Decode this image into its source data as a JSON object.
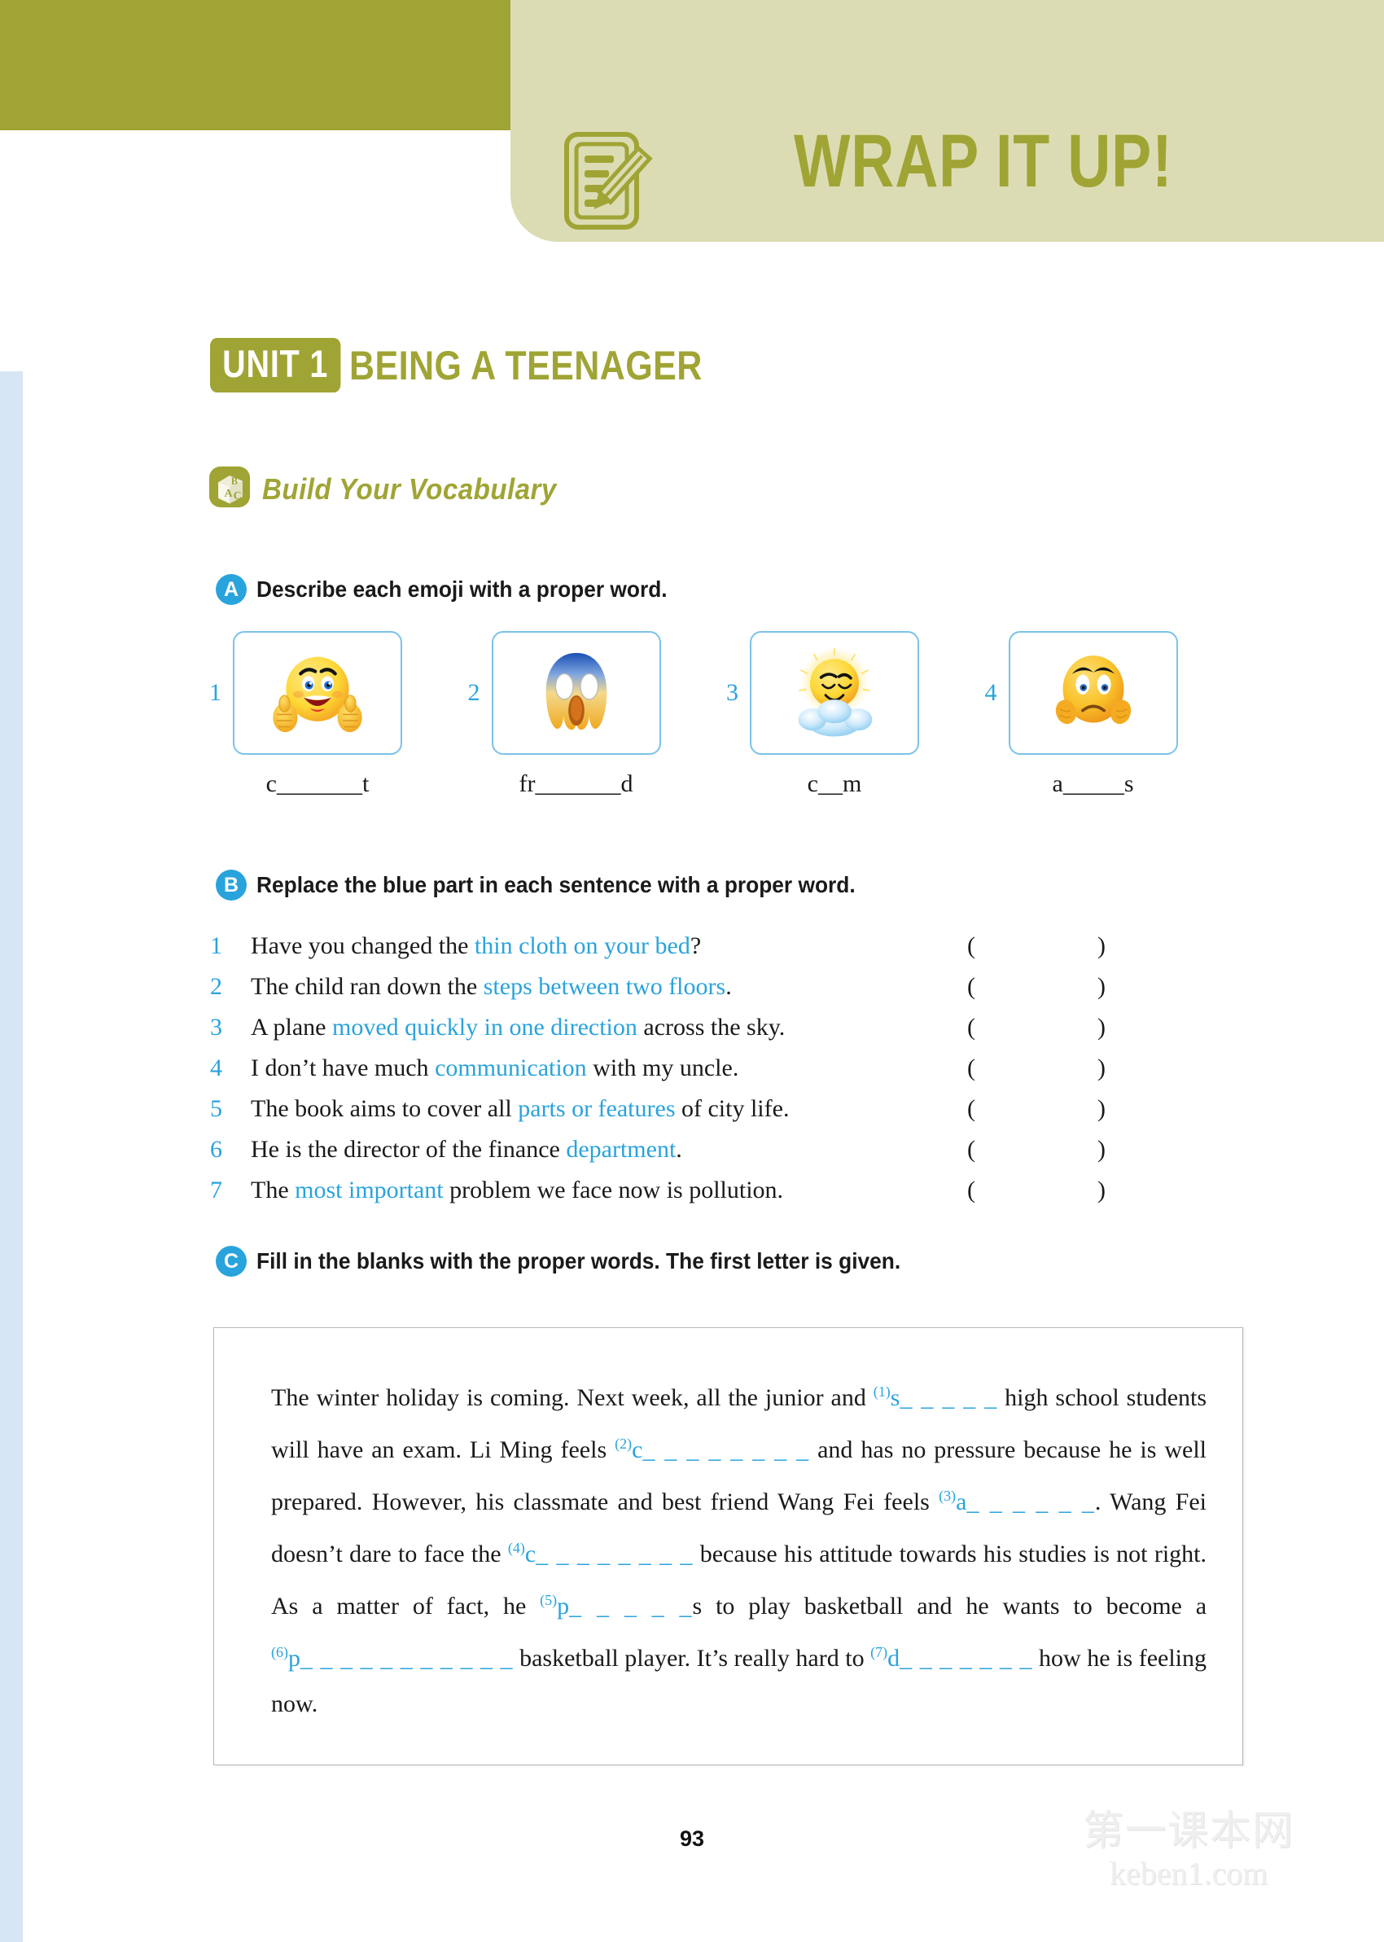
{
  "header": {
    "title": "WRAP IT UP!",
    "icon": "notepad-pencil-icon",
    "accent_color": "#a0a434",
    "band_color": "#dcdcb4"
  },
  "unit": {
    "badge": "UNIT 1",
    "name": "BEING A TEENAGER"
  },
  "vocabulary": {
    "icon": "abc-block-icon",
    "label": "Build Your Vocabulary"
  },
  "sections": {
    "a": {
      "badge": "A",
      "instruction": "Describe each emoji with a proper word.",
      "items": [
        {
          "num": "1",
          "emoji": "thumbs-up-smiley-emoji",
          "answer": "c_______t"
        },
        {
          "num": "2",
          "emoji": "screaming-face-emoji",
          "answer": "fr_______d"
        },
        {
          "num": "3",
          "emoji": "sleeping-on-cloud-emoji",
          "answer": "c__m"
        },
        {
          "num": "4",
          "emoji": "worried-face-emoji",
          "answer": "a_____s"
        }
      ]
    },
    "b": {
      "badge": "B",
      "instruction": "Replace the blue part in each sentence with a proper word.",
      "open_paren": "(",
      "close_paren": ")",
      "items": [
        {
          "num": "1",
          "pre": "Have you changed the ",
          "blue": "thin cloth on your bed",
          "post": "?"
        },
        {
          "num": "2",
          "pre": "The child ran down the ",
          "blue": "steps between two floors",
          "post": "."
        },
        {
          "num": "3",
          "pre": "A plane ",
          "blue": "moved quickly in one direction",
          "post": " across the sky."
        },
        {
          "num": "4",
          "pre": "I don’t have much ",
          "blue": "communication",
          "post": " with my uncle."
        },
        {
          "num": "5",
          "pre": "The book aims to cover all ",
          "blue": "parts or features",
          "post": " of city life."
        },
        {
          "num": "6",
          "pre": "He is the director of the finance ",
          "blue": "department",
          "post": "."
        },
        {
          "num": "7",
          "pre": "The ",
          "blue": "most important",
          "post": " problem we face now is pollution."
        }
      ]
    },
    "c": {
      "badge": "C",
      "instruction": "Fill in the blanks with the proper words. The first letter is given.",
      "passage_segments": [
        {
          "type": "text",
          "value": "The winter holiday is coming. Next week, all the junior and "
        },
        {
          "type": "blank",
          "num": "(1)",
          "letter": "s",
          "dashes": "_ _ _ _ _"
        },
        {
          "type": "text",
          "value": " high school students will have an exam. Li Ming feels "
        },
        {
          "type": "blank",
          "num": "(2)",
          "letter": "c",
          "dashes": "_ _ _ _ _ _ _ _"
        },
        {
          "type": "text",
          "value": " and has no pressure because he is well prepared. However, his classmate and best friend Wang Fei feels "
        },
        {
          "type": "blank",
          "num": "(3)",
          "letter": "a",
          "dashes": "_ _ _ _ _ _"
        },
        {
          "type": "text",
          "value": ". Wang Fei doesn’t dare to face the "
        },
        {
          "type": "blank",
          "num": "(4)",
          "letter": "c",
          "dashes": "_ _ _ _ _ _ _ _"
        },
        {
          "type": "text",
          "value": " because his attitude towards his studies is not right. As a matter of fact, he "
        },
        {
          "type": "blank",
          "num": "(5)",
          "letter": "p",
          "dashes": "_ _ _ _ _"
        },
        {
          "type": "text",
          "value": "s to play basketball and he wants to become a "
        },
        {
          "type": "blank",
          "num": "(6)",
          "letter": "p",
          "dashes": "_ _ _ _ _ _ _ _ _ _ _"
        },
        {
          "type": "text",
          "value": " basketball player. It’s really hard to "
        },
        {
          "type": "blank",
          "num": "(7)",
          "letter": "d",
          "dashes": "_ _ _ _ _ _ _"
        },
        {
          "type": "text",
          "value": " how he is feeling now."
        }
      ]
    }
  },
  "footer": {
    "page_number": "93",
    "watermark_cn": "第一课本网",
    "watermark_en": "keben1.com"
  }
}
